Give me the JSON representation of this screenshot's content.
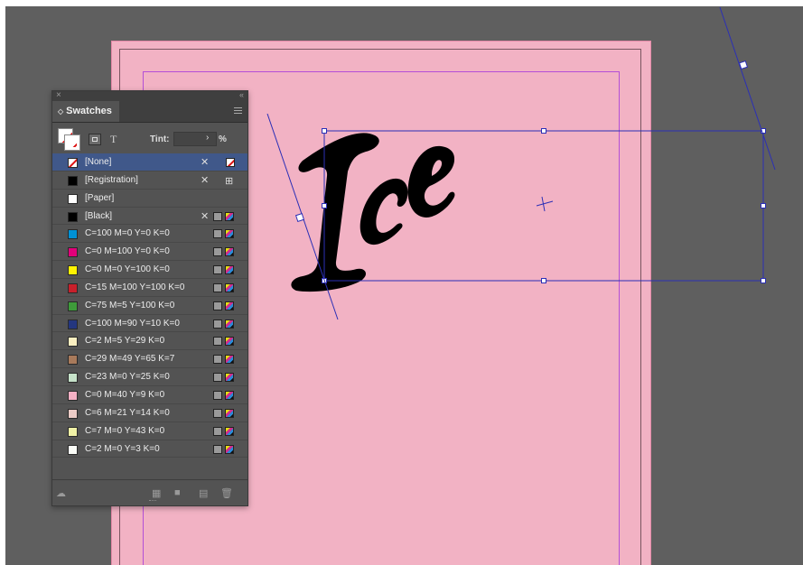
{
  "app": "Adobe InDesign",
  "document": {
    "page_color": "#f2b2c4",
    "pasteboard_color": "#5f5f5f",
    "frame_text": "Ice",
    "guide_color": "#b44fd7"
  },
  "swatches_panel": {
    "tab_label": "Swatches",
    "tint_label": "Tint:",
    "tint_value": "",
    "tint_unit": "%",
    "text_toggle_label": "T",
    "swatches": [
      {
        "name": "[None]",
        "color": "none",
        "selected": true,
        "kind": "none"
      },
      {
        "name": "[Registration]",
        "color": "#000000",
        "kind": "registration"
      },
      {
        "name": "[Paper]",
        "color": "#ffffff",
        "kind": "paper"
      },
      {
        "name": "[Black]",
        "color": "#000000",
        "kind": "black"
      },
      {
        "name": "C=100 M=0 Y=0 K=0",
        "color": "#0091d5",
        "kind": "process"
      },
      {
        "name": "C=0 M=100 Y=0 K=0",
        "color": "#e2007a",
        "kind": "process"
      },
      {
        "name": "C=0 M=0 Y=100 K=0",
        "color": "#fff200",
        "kind": "process"
      },
      {
        "name": "C=15 M=100 Y=100 K=0",
        "color": "#c8202b",
        "kind": "process"
      },
      {
        "name": "C=75 M=5 Y=100 K=0",
        "color": "#3e9b3a",
        "kind": "process"
      },
      {
        "name": "C=100 M=90 Y=10 K=0",
        "color": "#24367f",
        "kind": "process"
      },
      {
        "name": "C=2 M=5 Y=29 K=0",
        "color": "#f9eec0",
        "kind": "process"
      },
      {
        "name": "C=29 M=49 Y=65 K=7",
        "color": "#a87a5b",
        "kind": "process"
      },
      {
        "name": "C=23 M=0 Y=25 K=0",
        "color": "#c6e2c9",
        "kind": "process"
      },
      {
        "name": "C=0 M=40 Y=9 K=0",
        "color": "#f4b0c4",
        "kind": "process"
      },
      {
        "name": "C=6 M=21 Y=14 K=0",
        "color": "#ecccc7",
        "kind": "process"
      },
      {
        "name": "C=7 M=0 Y=43 K=0",
        "color": "#f0f1a6",
        "kind": "process"
      },
      {
        "name": "C=2 M=0 Y=3 K=0",
        "color": "#fafcf7",
        "kind": "process"
      }
    ],
    "bottom_icons": [
      "show-kinds-icon",
      "new-color-group-icon",
      "new-swatch-icon",
      "delete-swatch-icon"
    ]
  }
}
